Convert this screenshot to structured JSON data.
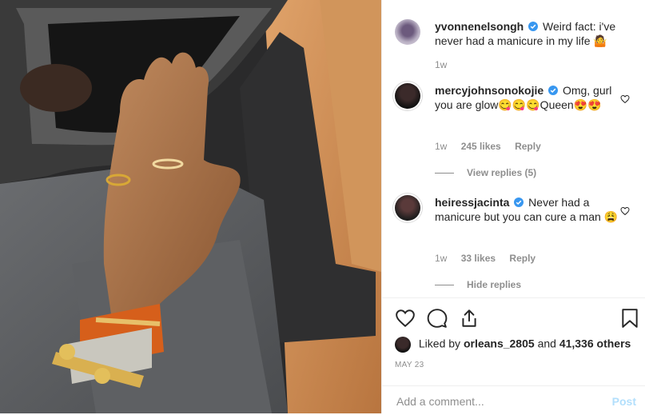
{
  "post": {
    "photo_alt": "hand with bracelets and ring in car"
  },
  "caption": {
    "username": "yvonnenelsongh",
    "text": "Weird fact: i've never had a manicure in my life 🤷",
    "time": "1w"
  },
  "comments": [
    {
      "username": "mercyjohnsonokojie",
      "text": "Omg, gurl you are glow😋😋😋Queen😍😍",
      "time": "1w",
      "likes": "245 likes",
      "reply": "Reply",
      "replies_toggle": "View replies (5)"
    },
    {
      "username": "heiressjacinta",
      "text": "Never had a manicure but you can cure a man 😩",
      "time": "1w",
      "likes": "33 likes",
      "reply": "Reply",
      "replies_toggle": "Hide replies"
    }
  ],
  "likes_line": {
    "prefix": "Liked by",
    "user": "orleans_2805",
    "middle": "and",
    "count": "41,336 others"
  },
  "date": "MAY 23",
  "add_comment": {
    "placeholder": "Add a comment...",
    "post_label": "Post"
  },
  "icons": [
    "verified-badge-icon",
    "heart-icon",
    "comment-icon",
    "share-icon",
    "bookmark-icon"
  ],
  "colors": {
    "verified": "#3897f0",
    "post_disabled": "#b2dffc",
    "muted": "#8e8e8e",
    "text": "#262626"
  }
}
